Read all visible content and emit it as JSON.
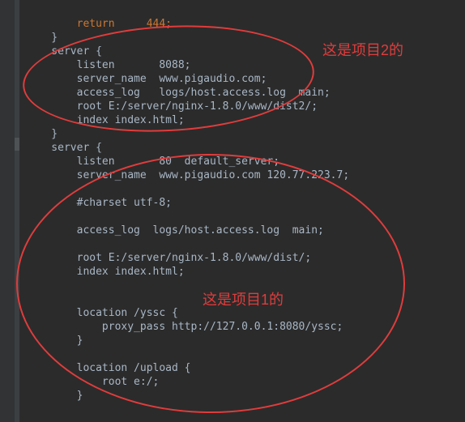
{
  "code": {
    "line1": "        return     444;",
    "line2": "    }",
    "line3": "    server {",
    "line4": "        listen       8088;",
    "line5": "        server_name  www.pigaudio.com;",
    "line6": "        access_log   logs/host.access.log  main;",
    "line7": "        root E:/server/nginx-1.8.0/www/dist2/;",
    "line8": "        index index.html;",
    "line9": "    }",
    "line10": "    server {",
    "line11": "        listen       80  default_server;",
    "line12": "        server_name  www.pigaudio.com 120.77.223.7;",
    "line13": "",
    "line14": "        #charset utf-8;",
    "line15": "",
    "line16": "        access_log  logs/host.access.log  main;",
    "line17": "",
    "line18": "        root E:/server/nginx-1.8.0/www/dist/;",
    "line19": "        index index.html;",
    "line20": "",
    "line21": "",
    "line22": "        location /yssc {",
    "line23": "            proxy_pass http://127.0.0.1:8080/yssc;",
    "line24": "        }",
    "line25": "",
    "line26": "        location /upload {",
    "line27": "            root e:/;",
    "line28": "        }"
  },
  "annotations": {
    "label1": "这是项目2的",
    "label2": "这是项目1的"
  }
}
